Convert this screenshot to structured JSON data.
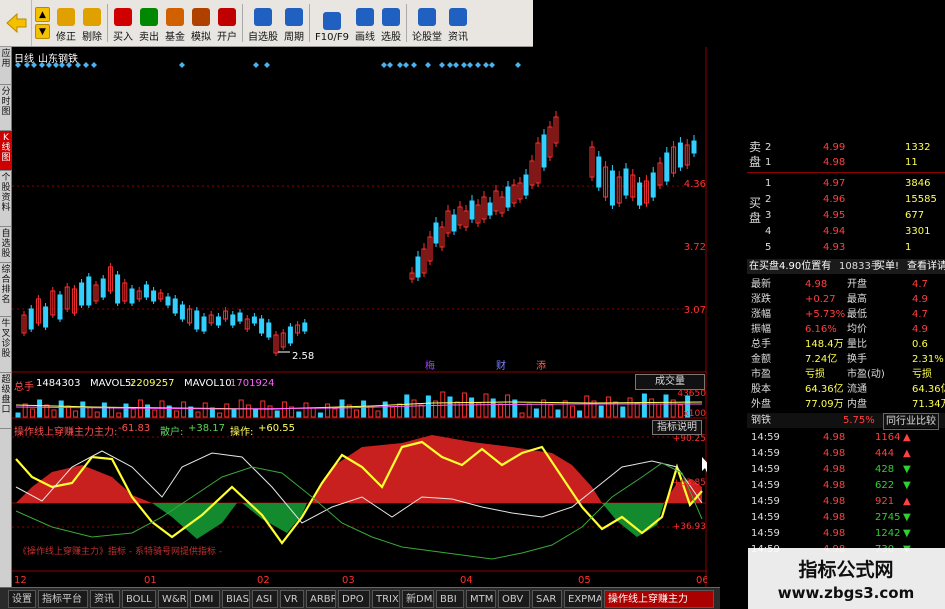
{
  "toolbar": {
    "buttons": [
      {
        "label": "修正",
        "icon": "refresh-icon",
        "color": "#e0a000"
      },
      {
        "label": "剔除",
        "icon": "exclude-icon",
        "color": "#e0a000"
      },
      {
        "label": "买入",
        "icon": "buy-icon",
        "color": "#d00000"
      },
      {
        "label": "卖出",
        "icon": "sell-icon",
        "color": "#008800"
      },
      {
        "label": "基金",
        "icon": "fund-icon",
        "color": "#d06000"
      },
      {
        "label": "模拟",
        "icon": "hammer-icon",
        "color": "#b04000"
      },
      {
        "label": "开户",
        "icon": "lock-icon",
        "color": "#c00000"
      },
      {
        "label": "自选股",
        "icon": "watchlist-icon",
        "color": "#2060c0"
      },
      {
        "label": "周期",
        "icon": "period-icon",
        "color": "#2060c0"
      },
      {
        "label": "F10/F9",
        "icon": "f10-icon",
        "color": "#2060c0"
      },
      {
        "label": "画线",
        "icon": "pen-icon",
        "color": "#2060c0"
      },
      {
        "label": "选股",
        "icon": "select-icon",
        "color": "#2060c0"
      },
      {
        "label": "论股堂",
        "icon": "forum-icon",
        "color": "#2060c0"
      },
      {
        "label": "资讯",
        "icon": "news-icon",
        "color": "#2060c0"
      }
    ]
  },
  "sidetabs": [
    "应用",
    "分时图",
    "K线图",
    "个股资料",
    "自选股",
    "综合排名",
    "牛叉诊股",
    "超级盘口"
  ],
  "chart": {
    "period": "日线",
    "stock": "山东钢铁",
    "price_labels": [
      "4.36",
      "3.72",
      "3.07"
    ],
    "low_mark": "2.58",
    "event_marks": [
      "梅",
      "财",
      "添"
    ],
    "volume": {
      "vol_label": "总手",
      "vol": "1484303",
      "ma5_label": "MAVOL5:",
      "ma5": "2209257",
      "ma10_label": "MAVOL10:",
      "ma10": "1701924",
      "dropdown": "成交量",
      "axis": [
        "43650",
        "x100"
      ]
    },
    "indicator": {
      "name": "操作线上穿赚主力",
      "main_label": "主力:",
      "main": "-61.83",
      "retail_label": "散户:",
      "retail": "+38.17",
      "op_label": "操作:",
      "op": "+60.55",
      "help": "指标说明",
      "axis": [
        "+90.25",
        "+63.85",
        "+36.93"
      ],
      "desc": "《操作线上穿赚主力》指标 - 系特骑号网提供指标 -"
    },
    "dates": [
      "12",
      "01",
      "02",
      "03",
      "04",
      "05",
      "06"
    ]
  },
  "quote": {
    "sell_label": "卖盘",
    "buy_label": "买盘",
    "sell": [
      {
        "n": "2",
        "p": "4.99",
        "v": "1332"
      },
      {
        "n": "1",
        "p": "4.98",
        "v": "11"
      }
    ],
    "buy": [
      {
        "n": "1",
        "p": "4.97",
        "v": "3846"
      },
      {
        "n": "2",
        "p": "4.96",
        "v": "15585"
      },
      {
        "n": "3",
        "p": "4.95",
        "v": "677"
      },
      {
        "n": "4",
        "p": "4.94",
        "v": "3301"
      },
      {
        "n": "5",
        "p": "4.93",
        "v": "1"
      }
    ],
    "strip": {
      "left": "在买盘4.90位置有",
      "mid": "10833手",
      "right1": "买单!",
      "right2": "查看详请"
    },
    "stats": [
      {
        "k1": "最新",
        "v1": "4.98",
        "k2": "开盘",
        "v2": "4.7"
      },
      {
        "k1": "涨跌",
        "v1": "+0.27",
        "k2": "最高",
        "v2": "4.9"
      },
      {
        "k1": "涨幅",
        "v1": "+5.73%",
        "k2": "最低",
        "v2": "4.7"
      },
      {
        "k1": "振幅",
        "v1": "6.16%",
        "k2": "均价",
        "v2": "4.9"
      },
      {
        "k1": "总手",
        "v1": "148.4万",
        "k2": "量比",
        "v2": "0.6"
      },
      {
        "k1": "金额",
        "v1": "7.24亿",
        "k2": "换手",
        "v2": "2.31%"
      },
      {
        "k1": "市盈",
        "v1": "亏损",
        "k2": "市盈(动)",
        "v2": "亏损"
      },
      {
        "k1": "股本",
        "v1": "64.36亿",
        "k2": "流通",
        "v2": "64.36亿"
      },
      {
        "k1": "外盘",
        "v1": "77.09万",
        "k2": "内盘",
        "v2": "71.34万"
      }
    ],
    "industry": {
      "name": "钢铁",
      "pct": "5.75%",
      "btn": "同行业比较"
    },
    "ticks": [
      {
        "t": "14:59",
        "p": "4.98",
        "v": "1164",
        "dir": "up"
      },
      {
        "t": "14:59",
        "p": "4.98",
        "v": "444",
        "dir": "up"
      },
      {
        "t": "14:59",
        "p": "4.98",
        "v": "428",
        "dir": "down"
      },
      {
        "t": "14:59",
        "p": "4.98",
        "v": "622",
        "dir": "down"
      },
      {
        "t": "14:59",
        "p": "4.98",
        "v": "921",
        "dir": "up"
      },
      {
        "t": "14:59",
        "p": "4.98",
        "v": "2745",
        "dir": "down"
      },
      {
        "t": "14:59",
        "p": "4.98",
        "v": "1242",
        "dir": "down"
      },
      {
        "t": "14:59",
        "p": "4.98",
        "v": "730",
        "dir": "down"
      }
    ]
  },
  "bottom_tabs": [
    "设置",
    "指标平台",
    "资讯",
    "BOLL",
    "W&R",
    "DMI",
    "BIAS",
    "ASI",
    "VR",
    "ARBR",
    "DPO",
    "TRIX",
    "新DMA",
    "BBI",
    "MTM",
    "OBV",
    "SAR",
    "EXPMA",
    "操作线上穿赚主力"
  ],
  "watermark": {
    "title": "指标公式网",
    "url": "www.zbgs3.com"
  },
  "colors": {
    "up": "#ff3030",
    "down": "#33d0ff",
    "grid": "#8b0000",
    "main_fill": "#c8201e",
    "neg_fill": "#138a2e",
    "op_line": "#ffff30",
    "white_line": "#e6e6e6",
    "green_line": "#3aa83a",
    "diamond": "#4ab2f0"
  }
}
